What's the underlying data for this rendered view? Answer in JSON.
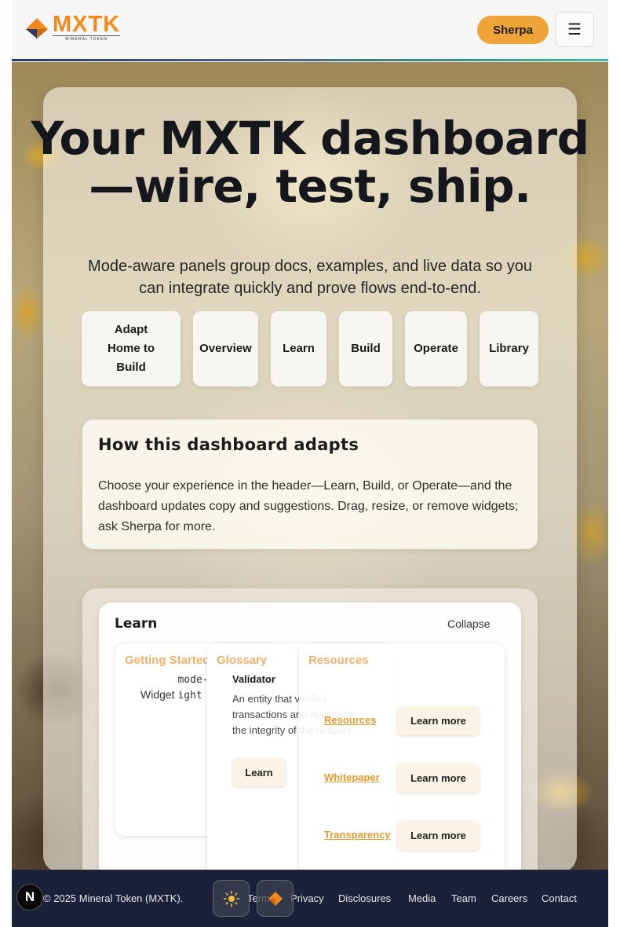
{
  "header": {
    "logo_text": "MXTK",
    "logo_sub": "MINERAL TOKEN",
    "sherpa_label": "Sherpa",
    "menu_glyph": "☰"
  },
  "hero": {
    "title": "Your MXTK dashboard—wire, test, ship.",
    "subtitle": "Mode-aware panels group docs, examples, and live data so you can integrate quickly and prove flows end-to-end."
  },
  "tabs": [
    {
      "label": "Adapt Home to Build"
    },
    {
      "label": "Overview"
    },
    {
      "label": "Learn"
    },
    {
      "label": "Build"
    },
    {
      "label": "Operate"
    },
    {
      "label": "Library"
    }
  ],
  "adapt": {
    "title": "How this dashboard adapts",
    "body": "Choose your experience in the header—Learn, Build, or Operate—and the dashboard updates copy and suggestions. Drag, resize, or remove widgets; ask Sherpa for more."
  },
  "learn_panel": {
    "heading": "Learn",
    "collapse_label": "Collapse",
    "getting_started": {
      "title": "Getting Started",
      "text_prefix": "Widget ",
      "code": "mode-highlight"
    },
    "glossary": {
      "title": "Glossary",
      "term": "Validator",
      "definition": "An entity that verifies transactions and maintains the integrity of the network",
      "button": "Learn"
    },
    "resources": {
      "title": "Resources",
      "items": [
        {
          "link": "Resources",
          "button": "Learn more"
        },
        {
          "link": "Whitepaper",
          "button": "Learn more"
        },
        {
          "link": "Transparency",
          "button": "Learn more"
        }
      ]
    }
  },
  "footer": {
    "copyright": "© 2025 Mineral Token (MXTK).",
    "links": [
      "Terms",
      "Privacy",
      "Disclosures",
      "Media",
      "Team",
      "Careers",
      "Contact"
    ],
    "badge": "N"
  },
  "colors": {
    "accent": "#efa43a",
    "footer_bg": "#1a2138",
    "link": "#e39b2f"
  }
}
